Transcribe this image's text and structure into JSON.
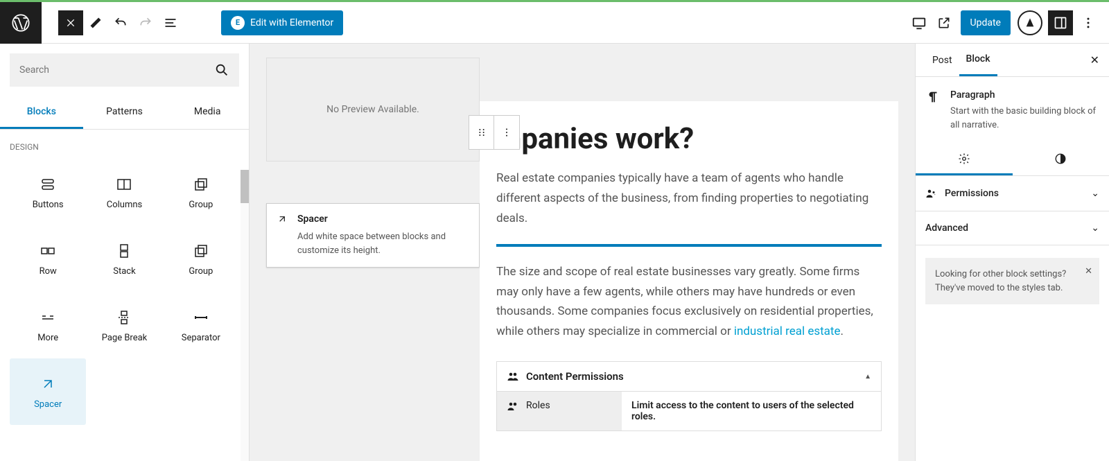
{
  "topbar": {
    "elementor_label": "Edit with Elementor",
    "update_label": "Update"
  },
  "left": {
    "search_placeholder": "Search",
    "tabs": [
      "Blocks",
      "Patterns",
      "Media"
    ],
    "category": "DESIGN",
    "blocks": [
      {
        "label": "Buttons"
      },
      {
        "label": "Columns"
      },
      {
        "label": "Group"
      },
      {
        "label": "Row"
      },
      {
        "label": "Stack"
      },
      {
        "label": "Group"
      },
      {
        "label": "More"
      },
      {
        "label": "Page Break"
      },
      {
        "label": "Separator"
      },
      {
        "label": "Spacer"
      }
    ]
  },
  "preview": {
    "text": "No Preview Available."
  },
  "tooltip": {
    "title": "Spacer",
    "desc": "Add white space between blocks and customize its height."
  },
  "content": {
    "heading": "mpanies work?",
    "para1": "Real estate companies typically have a team of agents who handle different aspects of the business, from finding properties to negotiating deals.",
    "para2a": "The size and scope of real estate businesses vary greatly. Some firms may only have a few agents, while others may have hundreds or even thousands. Some companies focus exclusively on residential properties, while others may specialize in commercial or ",
    "para2_link": "industrial real estate",
    "para2b": "."
  },
  "permissions": {
    "header": "Content Permissions",
    "sidebar": "Roles",
    "body": "Limit access to the content to users of the selected roles."
  },
  "right": {
    "tabs": [
      "Post",
      "Block"
    ],
    "block_title": "Paragraph",
    "block_desc": "Start with the basic building block of all narrative.",
    "sections": [
      "Permissions",
      "Advanced"
    ],
    "notice": "Looking for other block settings? They've moved to the styles tab."
  }
}
